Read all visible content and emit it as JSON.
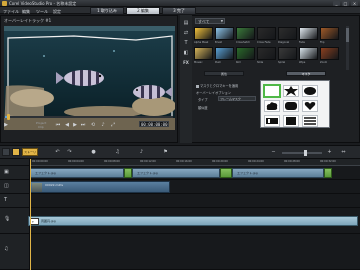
{
  "window": {
    "title": "Corel VideoStudio Pro - 名称未設定",
    "buttons": [
      "_",
      "□",
      "×"
    ]
  },
  "menu": [
    "ファイル",
    "編集",
    "ツール",
    "設定"
  ],
  "steps": [
    {
      "label": "1 取り込み",
      "active": false
    },
    {
      "label": "2 編集",
      "active": true
    },
    {
      "label": "3 完了",
      "active": false
    }
  ],
  "preview": {
    "caption": "オーバーレイトラック #1",
    "project_label": "Project",
    "clip_label": "Clip",
    "timecode": "00:00:00:00",
    "progress": 0.02,
    "buttons": [
      "play-icon",
      "home-icon",
      "prev-frame-icon",
      "next-frame-icon",
      "end-icon",
      "repeat-icon",
      "volume-icon",
      "enlarge-icon"
    ]
  },
  "library": {
    "dropdown": "すべて",
    "thumbs": [
      {
        "label": "Alpha Mask",
        "color": "#f1c13b"
      },
      {
        "label": "Brush",
        "color": "#8dc4e8"
      },
      {
        "label": "Crosshatch",
        "color": "#3a7a3a"
      },
      {
        "label": "Cross Fade",
        "color": "#2a2a2a"
      },
      {
        "label": "Diagonal",
        "color": "#2d2d2d"
      },
      {
        "label": "Fade",
        "color": "#e0e8ee"
      },
      {
        "label": "Flip",
        "color": "#a05a28"
      },
      {
        "label": "Mosaic",
        "color": "#d4b35a"
      },
      {
        "label": "Push",
        "color": "#5aa0d4"
      },
      {
        "label": "Roll",
        "color": "#2a6a2a"
      },
      {
        "label": "Slide",
        "color": "#2a2a2a"
      },
      {
        "label": "Spiral",
        "color": "#3a3a3a"
      },
      {
        "label": "Wipe",
        "color": "#d8e3ea"
      },
      {
        "label": "Zoom",
        "color": "#8a4020"
      }
    ],
    "subtabs": [
      {
        "label": "属性",
        "active": false
      },
      {
        "label": "マスク",
        "active": true
      }
    ],
    "options": {
      "apply_mask": "マスクとクロマキーを適用",
      "overlay_label": "オーバーレイオプション",
      "type_label": "タイプ",
      "type_value": "フレームマスク",
      "similar_label": "類似度"
    }
  },
  "timeline": {
    "tools": [
      "undo-icon",
      "redo-icon",
      "record-icon",
      "audio-mix-icon",
      "auto-music-icon",
      "chapter-icon"
    ],
    "storyboard_label": "ストーリーボード",
    "ruler": [
      "00:00:00:00",
      "00:00:04:00",
      "00:00:08:00",
      "00:00:12:00",
      "00:00:16:00",
      "00:00:20:00",
      "00:00:24:00",
      "00:00:28:00",
      "00:00:32:00"
    ],
    "tracks": [
      {
        "icon": "video-track-icon",
        "clips": [
          {
            "kind": "image",
            "label": "エフェクト.jpg"
          },
          {
            "kind": "image",
            "label": "エフェクト.jpg"
          },
          {
            "kind": "image",
            "label": "エフェクト.jpg"
          }
        ]
      },
      {
        "icon": "overlay-track-icon",
        "clip": "00022.m2ts"
      },
      {
        "icon": "title-track-icon"
      },
      {
        "icon": "voice-track-icon",
        "clip": "周囲円.jpg",
        "tbox": "T"
      },
      {
        "icon": "music-track-icon"
      }
    ]
  }
}
